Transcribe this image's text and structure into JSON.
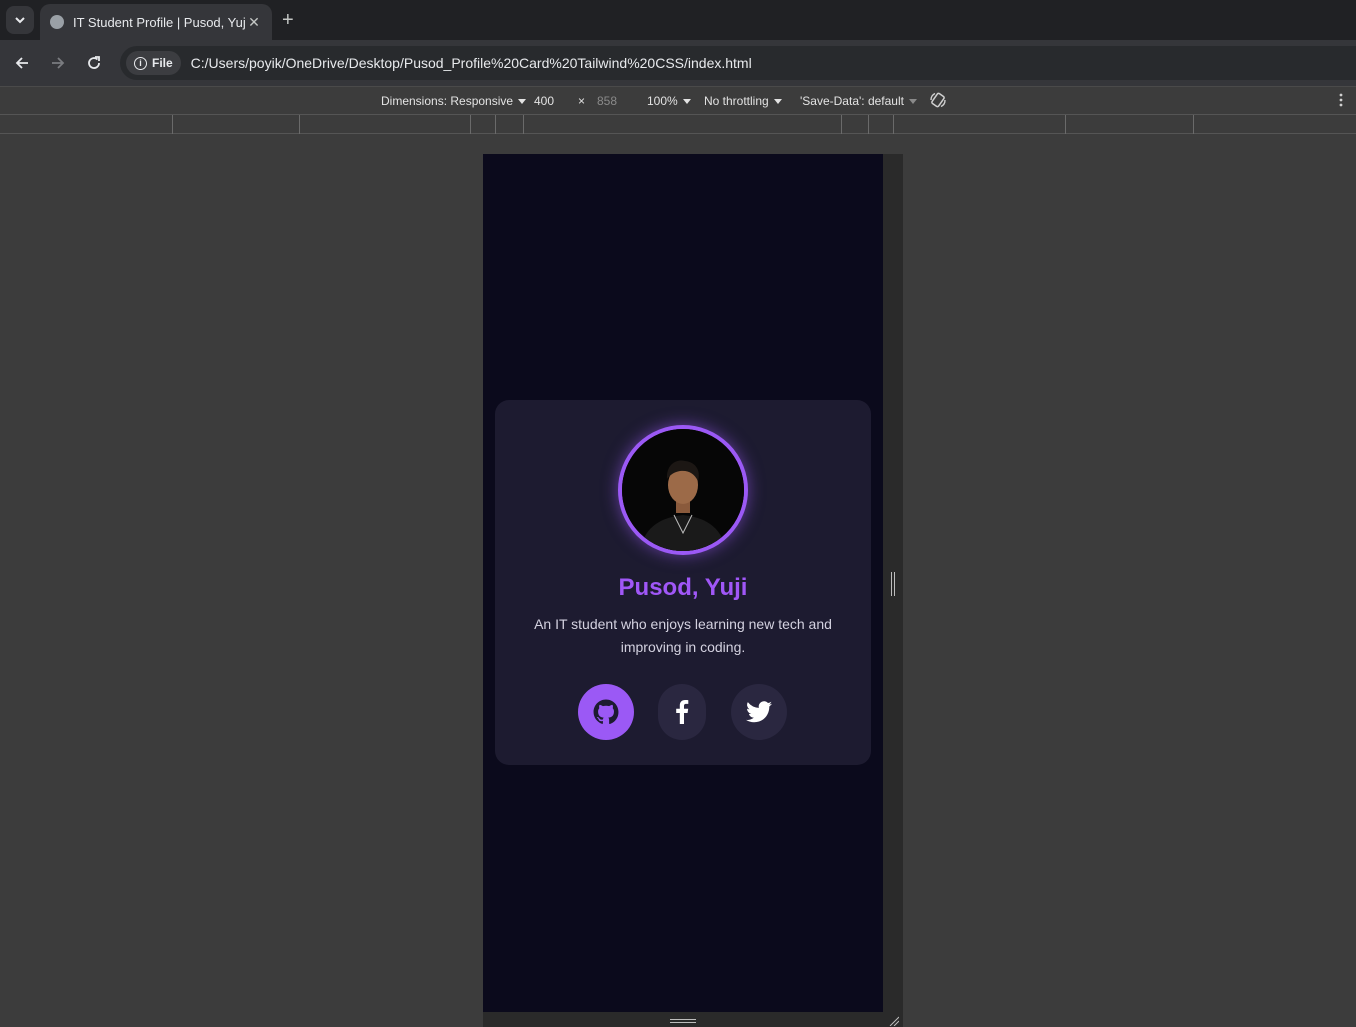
{
  "browser": {
    "tab_title": "IT Student Profile | Pusod, Yuji",
    "address_chip": "File",
    "url": "C:/Users/poyik/OneDrive/Desktop/Pusod_Profile%20Card%20Tailwind%20CSS/index.html"
  },
  "devtools": {
    "dimensions_label": "Dimensions: Responsive",
    "width": "400",
    "times": "×",
    "height": "858",
    "zoom": "100%",
    "throttling": "No throttling",
    "save_data": "'Save-Data': default"
  },
  "profile": {
    "name": "Pusod, Yuji",
    "bio": "An IT student who enjoys learning new tech and improving in coding.",
    "socials": [
      {
        "icon": "github-icon",
        "active": true
      },
      {
        "icon": "facebook-icon",
        "active": false
      },
      {
        "icon": "twitter-icon",
        "active": false
      }
    ]
  },
  "colors": {
    "accent": "#9b59f5",
    "name": "#a057f7",
    "card": "#1d1b30",
    "page_bg": "#0b0a1c"
  }
}
